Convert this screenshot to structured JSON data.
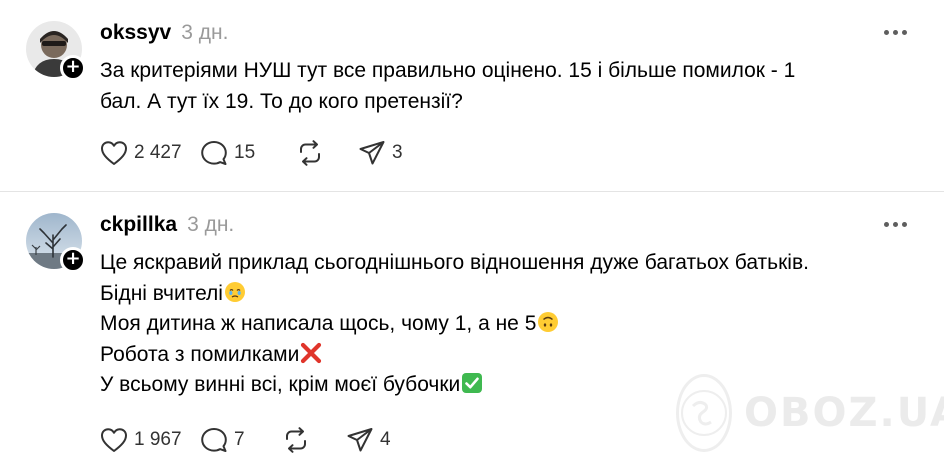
{
  "posts": [
    {
      "username": "okssyv",
      "time": "3 дн.",
      "lines": [
        "За критеріями НУШ тут все правильно оцінено. 15 і більше помилок - 1",
        "бал. А тут їх 19. То до кого претензії?"
      ],
      "likes": "2 427",
      "replies": "15",
      "reposts": "",
      "shares": "3",
      "avatar_icon": "profile-photo-person"
    },
    {
      "username": "ckpillka",
      "time": "3 дн.",
      "lines": [
        "Це яскравий приклад сьогоднішнього відношення дуже багатьох батьків.",
        "Бідні вчителі",
        "Моя дитина ж написала щось, чому 1, а не 5",
        "Робота з помилками",
        "У всьому винні всі, крім моєї бубочки"
      ],
      "line_emojis": [
        "",
        "face-holding-back-tears",
        "upside-down-face",
        "cross-mark",
        "check-mark-button"
      ],
      "likes": "1 967",
      "replies": "7",
      "reposts": "",
      "shares": "4",
      "avatar_icon": "profile-photo-tree"
    }
  ],
  "icons": {
    "like": "heart-icon",
    "reply": "speech-bubble-icon",
    "repost": "repost-arrows-icon",
    "share": "send-plane-icon",
    "more": "three-dots-icon",
    "follow": "plus-badge-icon"
  },
  "watermark": {
    "text": "OBOZ.UA"
  },
  "colors": {
    "text": "#000000",
    "muted": "#9a9a9a",
    "icon": "#333333",
    "divider": "#e4e4e4",
    "cross": "#e0352b",
    "check": "#3fb950"
  }
}
